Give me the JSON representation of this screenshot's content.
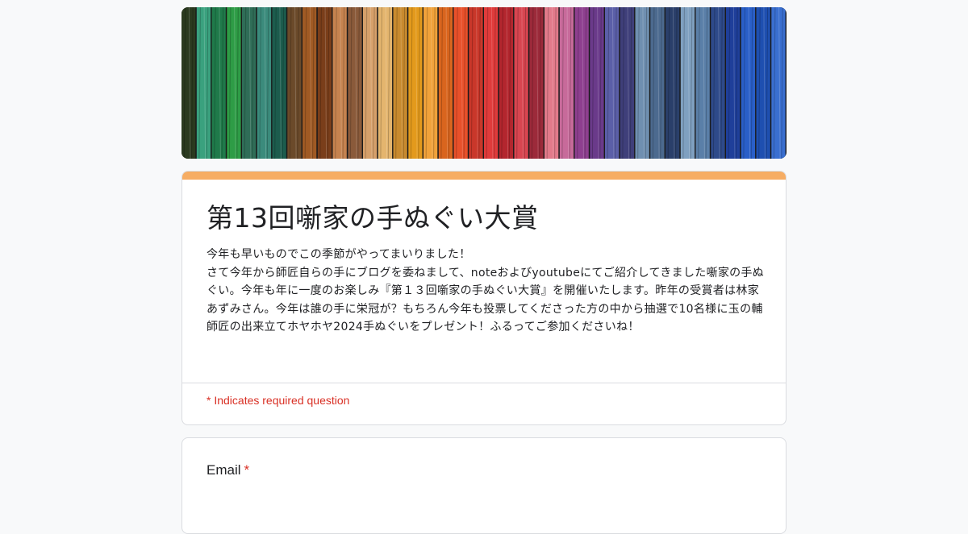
{
  "colors": {
    "accent": "#f6ad63",
    "required": "#d93025",
    "text": "#202124",
    "background": "#f8f9fa",
    "yarn_strands": [
      "#2b3a1f",
      "#3aa17e",
      "#1f7a4a",
      "#2e9c46",
      "#2f6d57",
      "#3b8b7c",
      "#1c5c4d",
      "#6b4a2a",
      "#a05a24",
      "#7a3e1a",
      "#c6834f",
      "#8a5a3a",
      "#d6a06a",
      "#e4b56e",
      "#c88a2e",
      "#e39a1c",
      "#f0a23a",
      "#d9651e",
      "#e8502a",
      "#c9372a",
      "#e03b3b",
      "#b3262e",
      "#d84550",
      "#9c2a3a",
      "#e27a8a",
      "#c76a9a",
      "#8e3f8f",
      "#6a3a8a",
      "#5b5fa8",
      "#3f3f7a",
      "#6f8fb0",
      "#4c6a8f",
      "#2a3f6a",
      "#7fa0c0",
      "#5a7fa8",
      "#2e4a8a",
      "#1f3f9a",
      "#2a5fc8",
      "#1e4fb0",
      "#3a6fd0"
    ]
  },
  "banner": {
    "icon": "yarn-banner-image"
  },
  "form": {
    "title": "第13回噺家の手ぬぐい大賞",
    "description": "今年も早いものでこの季節がやってまいりました！\nさて今年から師匠自らの手にブログを委ねまして、noteおよびyoutubeにてご紹介してきました噺家の手ぬぐい。今年も年に一度のお楽しみ『第１３回噺家の手ぬぐい大賞』を開催いたします。昨年の受賞者は林家あずみさん。今年は誰の手に栄冠が？もちろん今年も投票してくださった方の中から抽選で10名様に玉の輔師匠の出来立てホヤホヤ2024手ぬぐいをプレゼント！ふるってご参加くださいね！",
    "required_note": "* Indicates required question"
  },
  "questions": [
    {
      "label": "Email",
      "required_mark": "*"
    }
  ]
}
